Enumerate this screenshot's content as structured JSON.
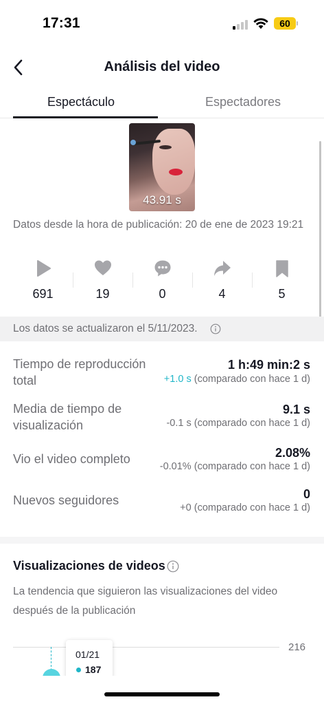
{
  "status_bar": {
    "time": "17:31",
    "battery": "60",
    "battery_color": "#f7cb15"
  },
  "nav": {
    "title": "Análisis del video",
    "back_icon": "chevron-left-icon"
  },
  "tabs": [
    {
      "label": "Espectáculo",
      "active": true
    },
    {
      "label": "Espectadores",
      "active": false
    }
  ],
  "video": {
    "duration": "43.91 s",
    "published": "Datos desde la hora de publicación: 20 de ene de 2023 19:21"
  },
  "metrics": [
    {
      "icon": "play-icon",
      "value": "691"
    },
    {
      "icon": "heart-icon",
      "value": "19"
    },
    {
      "icon": "comment-icon",
      "value": "0"
    },
    {
      "icon": "share-icon",
      "value": "4"
    },
    {
      "icon": "bookmark-icon",
      "value": "5"
    }
  ],
  "updated": {
    "text": "Los datos se actualizaron el 5/11/2023."
  },
  "stats": [
    {
      "label": "Tiempo de reproducción total",
      "value": "1 h:49 min:2 s",
      "delta": "+1.0 s",
      "compare": "(comparado con hace 1 d)"
    },
    {
      "label": "Media de tiempo de visualización",
      "value": "9.1 s",
      "delta": "-0.1 s",
      "compare": "(comparado con hace 1 d)"
    },
    {
      "label": "Vio el video completo",
      "value": "2.08%",
      "delta": "-0.01%",
      "compare": "(comparado con hace 1 d)"
    },
    {
      "label": "Nuevos seguidores",
      "value": "0",
      "delta": "+0",
      "compare": "(comparado con hace 1 d)"
    }
  ],
  "views_section": {
    "title": "Visualizaciones de videos",
    "description": "La tendencia que siguieron las visualizaciones del video después de la publicación"
  },
  "chart_data": {
    "type": "line",
    "y_max_label": "216",
    "tooltip": {
      "date": "01/21",
      "value": "187"
    },
    "accent": "#20b6c8"
  }
}
